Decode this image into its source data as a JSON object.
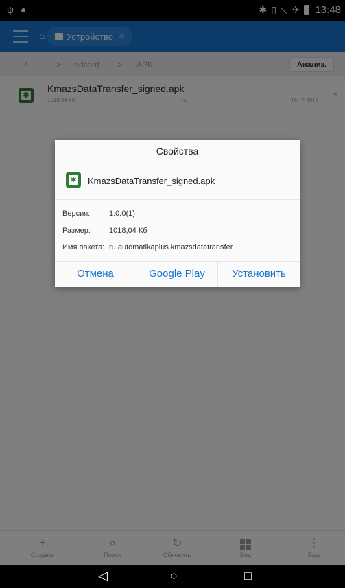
{
  "status_bar": {
    "time": "13:48",
    "left_icons": [
      "usb-icon",
      "android-debug-icon"
    ],
    "right_icons": [
      "bluetooth-icon",
      "vibrate-icon",
      "no-signal-icon",
      "airplane-icon",
      "battery-icon"
    ]
  },
  "app_bar": {
    "location_chip": "Устройство"
  },
  "breadcrumb": {
    "root": "/",
    "items": [
      "sdcard",
      "APK"
    ],
    "analyze_button": "Анализ."
  },
  "file_list": [
    {
      "name": "KmazsDataTransfer_signed.apk",
      "size": "1018,04 Кб",
      "permissions": "-rw",
      "date": "19.12.2017"
    }
  ],
  "dialog": {
    "title": "Свойства",
    "file_name": "KmazsDataTransfer_signed.apk",
    "properties": {
      "version_label": "Версия:",
      "version_value": "1.0.0(1)",
      "size_label": "Размер:",
      "size_value": "1018,04 Кб",
      "package_label": "Имя пакета:",
      "package_value": "ru.automatikaplus.kmazsdatatransfer"
    },
    "buttons": {
      "cancel": "Отмена",
      "google_play": "Google Play",
      "install": "Установить"
    }
  },
  "toolbar": {
    "create": "Создать",
    "search": "Поиск",
    "refresh": "Обновить",
    "view": "Вид",
    "more": "Еще"
  },
  "colors": {
    "app_bar": "#1976d2",
    "accent": "#1976d2",
    "apk_icon": "#2e7d32"
  }
}
